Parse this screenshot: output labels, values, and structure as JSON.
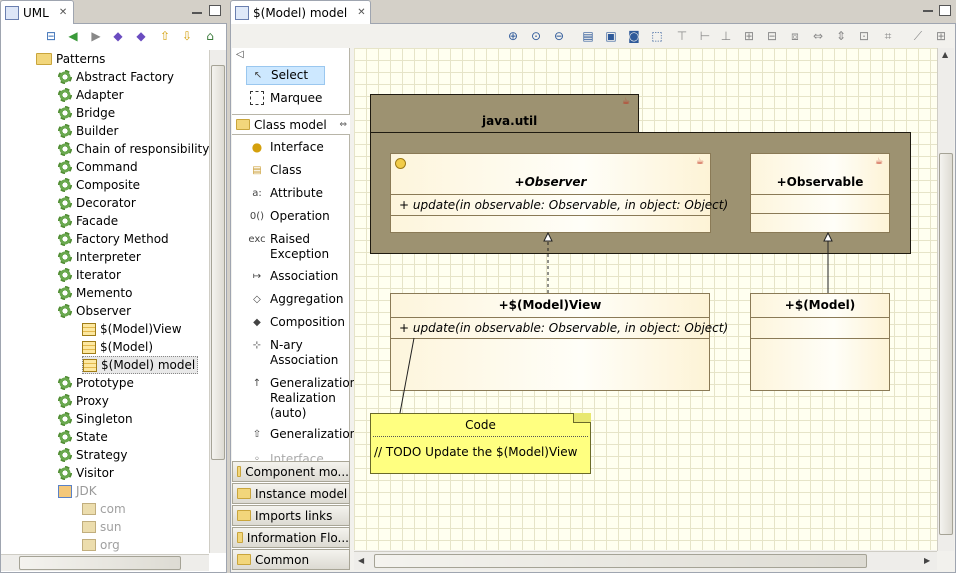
{
  "left_view": {
    "tab_title": "UML",
    "tree": {
      "root": "Patterns",
      "patterns": [
        "Abstract Factory",
        "Adapter",
        "Bridge",
        "Builder",
        "Chain of responsibility",
        "Command",
        "Composite",
        "Decorator",
        "Facade",
        "Factory Method",
        "Interpreter",
        "Iterator",
        "Memento",
        "Observer"
      ],
      "observer_children": [
        "$(Model)View",
        "$(Model)",
        "$(Model) model"
      ],
      "patterns_after": [
        "Prototype",
        "Proxy",
        "Singleton",
        "State",
        "Strategy",
        "Visitor"
      ],
      "jdk": "JDK",
      "jdk_children": [
        "com",
        "sun",
        "org"
      ]
    }
  },
  "editor": {
    "tab_title": "$(Model) model"
  },
  "palette": {
    "select": "Select",
    "marquee": "Marquee",
    "class_model_drawer": "Class model",
    "tools": [
      "Interface",
      "Class",
      "Attribute",
      "Operation",
      "Raised Exception",
      "Association",
      "Aggregation",
      "Composition",
      "N-ary Association",
      "Generalization/ Realization (auto)",
      "Generalization"
    ],
    "partial_tool": "Interface",
    "drawers": [
      "Component mo...",
      "Instance model",
      "Imports links",
      "Information Flo...",
      "Common"
    ]
  },
  "diagram": {
    "package_name": "java.util",
    "observer": {
      "name": "+Observer",
      "operation": "+ update(in observable: Observable, in object: Object)"
    },
    "observable": {
      "name": "+Observable"
    },
    "view": {
      "name": "+$(Model)View",
      "operation": "+ update(in observable: Observable, in object: Object)"
    },
    "model": {
      "name": "+$(Model)"
    },
    "note": {
      "title": "Code",
      "body": "// TODO Update the $(Model)View"
    }
  },
  "colors": {
    "package_fill": "#9d9271",
    "note_fill": "#ffff80",
    "selection": "#cde8ff"
  }
}
